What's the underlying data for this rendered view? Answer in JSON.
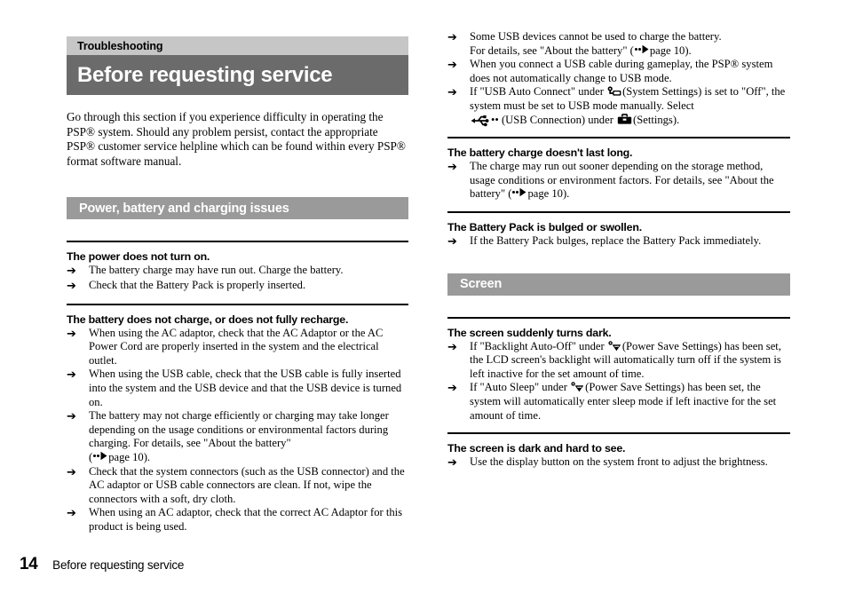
{
  "chapter": {
    "label": "Troubleshooting"
  },
  "page_title": "Before requesting service",
  "intro": "Go through this section if you experience difficulty in operating the PSP® system. Should any problem persist, contact the appropriate PSP® customer service helpline which can be found within every PSP® format software manual.",
  "sections": {
    "power": {
      "label": "Power, battery and charging issues"
    },
    "screen": {
      "label": "Screen"
    }
  },
  "left_column": {
    "blocks": [
      {
        "question": "The power does not turn on.",
        "answers": [
          "The battery charge may have run out. Charge the battery.",
          "Check that the Battery Pack is properly inserted."
        ]
      },
      {
        "question": "The battery does not charge, or does not fully recharge.",
        "answers": [
          "When using the AC adaptor, check that the AC Adaptor or the AC Power Cord are properly inserted in the system and the electrical outlet.",
          "When using the USB cable, check that the USB cable is fully inserted into the system and the USB device and that the USB device is turned on.",
          "The battery may not charge efficiently or charging may take longer depending on the usage conditions or environmental factors during charging. For details, see \"About the battery\"",
          "Check that the system connectors (such as the USB connector) and the AC adaptor or USB cable connectors are clean. If not, wipe the connectors with a soft, dry cloth.",
          "When using an AC adaptor, check that the correct AC Adaptor for this product is being used."
        ],
        "page_ref_trailing": "page 10)."
      }
    ]
  },
  "right_column": {
    "continued_answers": {
      "usb_devices_line1": "Some USB devices cannot be used to charge the battery.",
      "usb_devices_line2_pre": "For details, see \"About the battery\" (",
      "usb_devices_line2_post": "page 10).",
      "gameplay": "When you connect a USB cable during gameplay, the PSP® system does not automatically change to USB mode.",
      "auto_connect_pre": "If \"USB Auto Connect\" under",
      "auto_connect_mid": "(System Settings) is set to \"Off\", the system must be set to USB mode manually. Select",
      "auto_connect_usb_label": "•• (USB Connection) under",
      "auto_connect_post": "(Settings)."
    },
    "blocks": [
      {
        "question": "The battery charge doesn't last long.",
        "answer_pre": "The charge may run out sooner depending on the storage method, usage conditions or environment factors. For details, see \"About the battery\" (",
        "answer_post": "page 10)."
      },
      {
        "question": "The Battery Pack is bulged or swollen.",
        "answers": [
          "If the Battery Pack bulges, replace the Battery Pack immediately."
        ]
      }
    ],
    "screen_blocks": [
      {
        "question": "The screen suddenly turns dark.",
        "answers": [
          {
            "pre": "If \"Backlight Auto-Off\" under",
            "post": "(Power Save Settings) has been set, the LCD screen's backlight will automatically turn off if the system is left inactive for the set amount of time."
          },
          {
            "pre": "If \"Auto Sleep\" under",
            "post": "(Power Save Settings) has been set, the system will automatically enter sleep mode if left inactive for the set amount of time."
          }
        ]
      },
      {
        "question": "The screen is dark and hard to see.",
        "answers": [
          "Use the display button on the system front to adjust the brightness."
        ]
      }
    ]
  },
  "footer": {
    "page_number": "14",
    "running_head": "Before requesting service"
  },
  "icons": {
    "bullet_arrow": "right-arrow",
    "page_ref": "page-reference-marker",
    "system_settings": "system-settings-icon",
    "settings_toolbox": "settings-toolbox-icon",
    "usb_connection": "usb-icon",
    "power_save": "power-save-settings-icon"
  },
  "colors": {
    "chapter_bar": "#c6c6c6",
    "title_bar": "#6b6b6b",
    "section_bar": "#9a9a9a",
    "text": "#000000",
    "page_background": "#ffffff"
  }
}
